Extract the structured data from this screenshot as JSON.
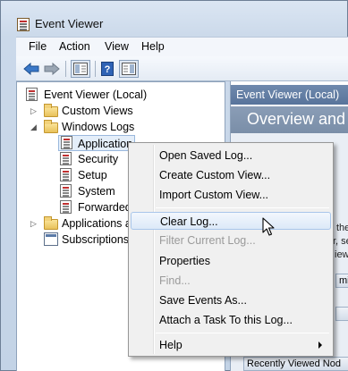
{
  "window": {
    "title": "Event Viewer"
  },
  "menubar": {
    "items": [
      "File",
      "Action",
      "View",
      "Help"
    ]
  },
  "toolbar": {
    "icons": [
      "back-arrow-icon",
      "forward-arrow-icon",
      "show-hide-tree-icon",
      "help-icon",
      "show-hide-action-pane-icon"
    ]
  },
  "tree": {
    "root": "Event Viewer (Local)",
    "custom_views": "Custom Views",
    "windows_logs": "Windows Logs",
    "logs": [
      "Application",
      "Security",
      "Setup",
      "System",
      "Forwarded"
    ],
    "apps_services": "Applications a",
    "subscriptions": "Subscriptions"
  },
  "right_pane": {
    "header": "Event Viewer (Local)",
    "banner": "Overview and",
    "fragments": [
      "the",
      "r, se",
      "iew"
    ],
    "bar_partial": "minist",
    "bottom_bar": "Recently Viewed Nod"
  },
  "context_menu": {
    "open_saved_log": "Open Saved Log...",
    "create_custom_view": "Create Custom View...",
    "import_custom_view": "Import Custom View...",
    "clear_log": "Clear Log...",
    "filter_current_log": "Filter Current Log...",
    "properties": "Properties",
    "find": "Find...",
    "save_events_as": "Save Events As...",
    "attach_task": "Attach a Task To this Log...",
    "help": "Help"
  },
  "colors": {
    "accent": "#58749b",
    "menu_hover": "#dce9f8"
  }
}
